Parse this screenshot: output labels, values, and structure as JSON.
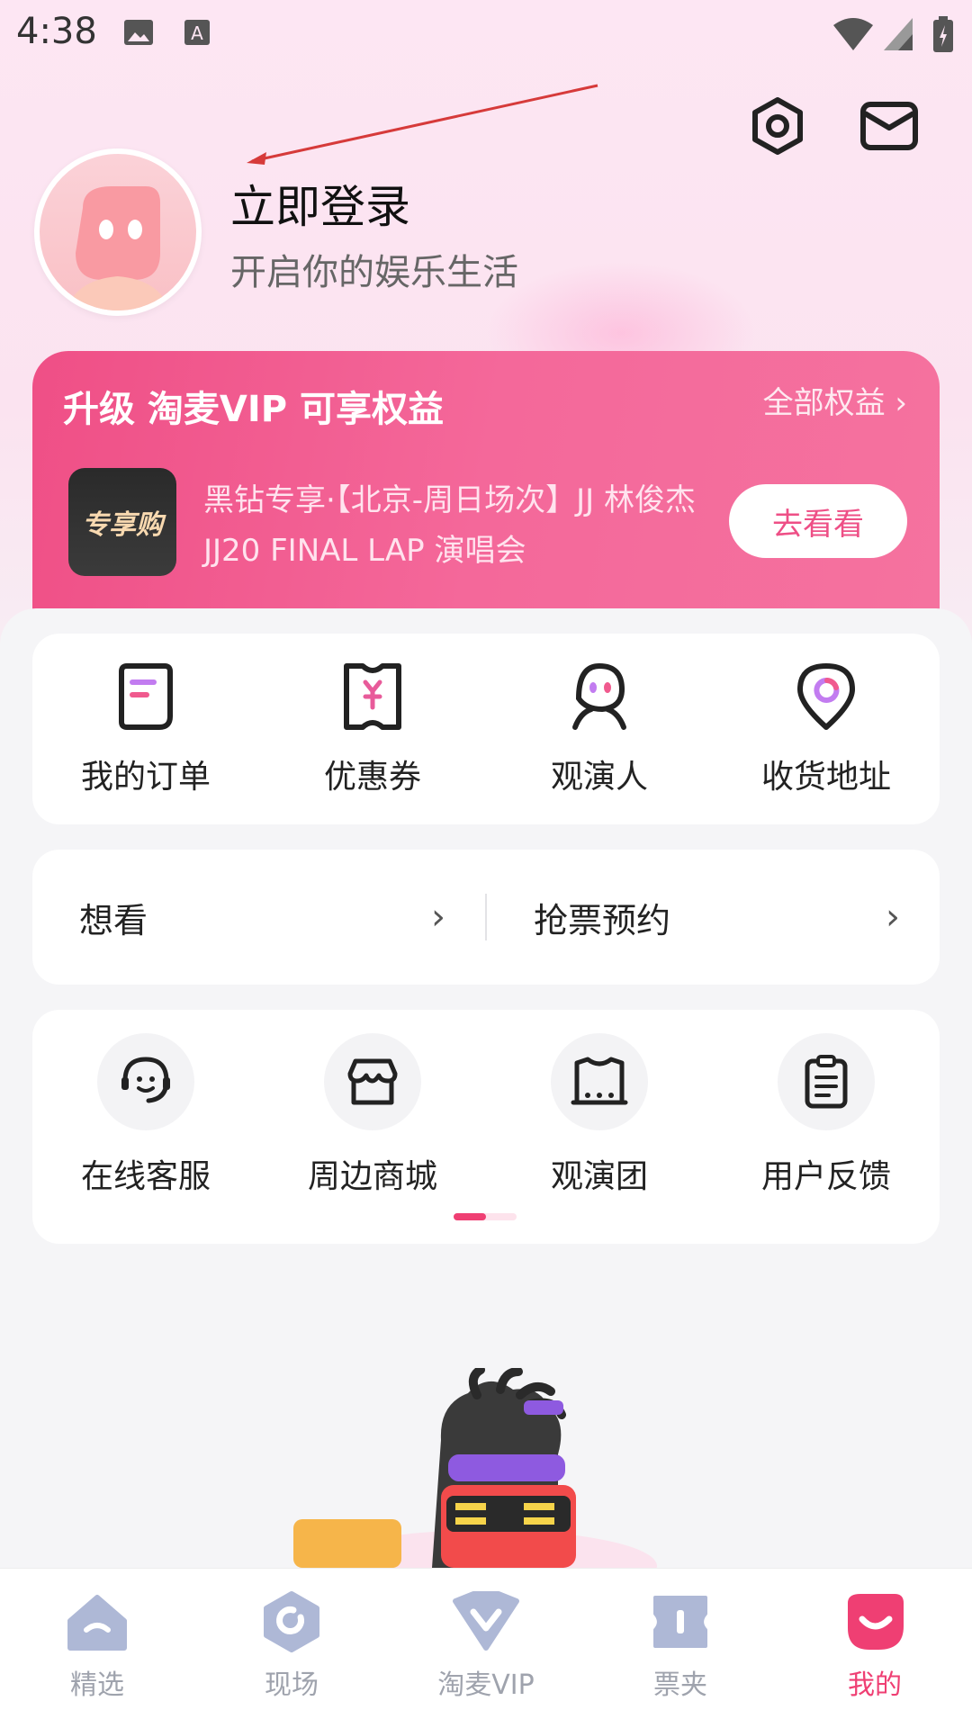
{
  "status_bar": {
    "time": "4:38"
  },
  "profile": {
    "login_title": "立即登录",
    "login_subtitle": "开启你的娱乐生活"
  },
  "vip": {
    "title": "升级 淘麦VIP 可享权益",
    "all_benefits": "全部权益 ›",
    "badge_text": "专享购",
    "description": "黑钻专享·【北京-周日场次】JJ 林俊杰 JJ20 FINAL LAP 演唱会",
    "go_button": "去看看"
  },
  "quick_actions": [
    {
      "label": "我的订单",
      "icon": "order-icon"
    },
    {
      "label": "优惠券",
      "icon": "coupon-icon"
    },
    {
      "label": "观演人",
      "icon": "audience-icon"
    },
    {
      "label": "收货地址",
      "icon": "address-icon"
    }
  ],
  "wish_row": {
    "want_to_see": "想看",
    "ticket_reservation": "抢票预约",
    "chevron": "›"
  },
  "services": [
    {
      "label": "在线客服",
      "icon": "customer-service-icon"
    },
    {
      "label": "周边商城",
      "icon": "shop-icon"
    },
    {
      "label": "观演团",
      "icon": "theater-group-icon"
    },
    {
      "label": "用户反馈",
      "icon": "feedback-icon"
    }
  ],
  "bottom_nav": [
    {
      "label": "精选",
      "icon": "home-icon",
      "active": false
    },
    {
      "label": "现场",
      "icon": "live-icon",
      "active": false
    },
    {
      "label": "淘麦VIP",
      "icon": "vip-icon",
      "active": false
    },
    {
      "label": "票夹",
      "icon": "ticket-icon",
      "active": false
    },
    {
      "label": "我的",
      "icon": "profile-icon",
      "active": true
    }
  ],
  "colors": {
    "accent": "#ef3f73",
    "vip_gradient_start": "#ef4f86",
    "nav_inactive": "#9fa3ad"
  }
}
